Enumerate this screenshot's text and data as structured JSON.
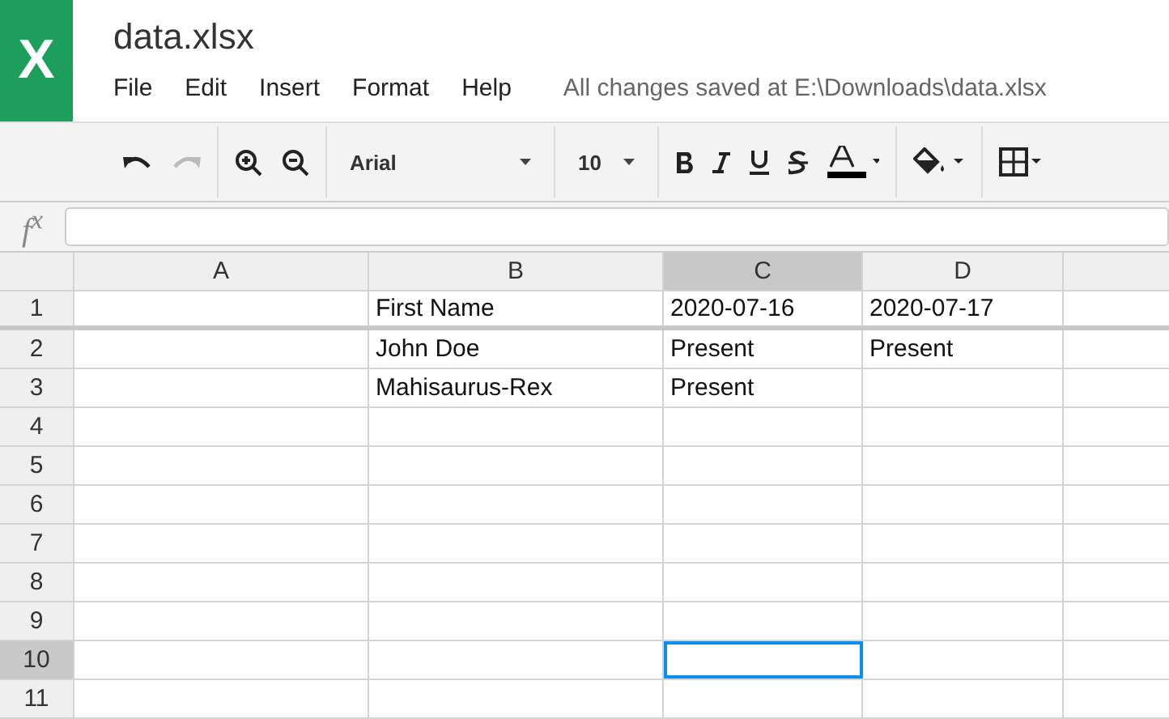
{
  "app": {
    "logo": "X",
    "title": "data.xlsx"
  },
  "menu": [
    "File",
    "Edit",
    "Insert",
    "Format",
    "Help"
  ],
  "save_status": "All changes saved at E:\\Downloads\\data.xlsx",
  "toolbar": [
    [
      {
        "kind": "undo",
        "disabled": false
      },
      {
        "kind": "redo",
        "disabled": true
      }
    ],
    [
      {
        "kind": "zoomin",
        "disabled": false
      },
      {
        "kind": "zoomout",
        "disabled": false
      }
    ],
    [
      {
        "kind": "font",
        "label": "Arial",
        "disabled": false
      }
    ],
    [
      {
        "kind": "size",
        "label": "10",
        "disabled": false
      }
    ],
    [
      {
        "kind": "bold",
        "disabled": false
      },
      {
        "kind": "italic",
        "disabled": false
      },
      {
        "kind": "underline",
        "disabled": false
      },
      {
        "kind": "strike",
        "disabled": false
      },
      {
        "kind": "textcolor",
        "disabled": false
      }
    ],
    [
      {
        "kind": "fillcolor",
        "disabled": false
      }
    ],
    [
      {
        "kind": "borders",
        "disabled": false
      }
    ]
  ],
  "formula_bar": {
    "label": "f$^{x}$"
  },
  "sheet": {
    "columns": [
      {
        "label": "A",
        "selected": false
      },
      {
        "label": "B",
        "selected": false
      },
      {
        "label": "C",
        "selected": true
      },
      {
        "label": "D",
        "selected": false
      },
      {
        "selected": false
      }
    ],
    "rows": [
      {
        "label": "1",
        "selected": false,
        "frozen": true,
        "cells": [
          null,
          "First Name",
          "2020-07-16",
          "2020-07-17",
          null
        ]
      },
      {
        "label": "2",
        "selected": false,
        "frozen": false,
        "cells": [
          null,
          "John Doe",
          "Present",
          "Present",
          null
        ]
      },
      {
        "label": "3",
        "selected": false,
        "frozen": false,
        "cells": [
          null,
          "Mahisaurus-Rex",
          "Present",
          null,
          null
        ]
      },
      {
        "label": "4",
        "selected": false,
        "frozen": false,
        "cells": [
          null,
          null,
          null,
          null,
          null
        ]
      },
      {
        "label": "5",
        "selected": false,
        "frozen": false,
        "cells": [
          null,
          null,
          null,
          null,
          null
        ]
      },
      {
        "label": "6",
        "selected": false,
        "frozen": false,
        "cells": [
          null,
          null,
          null,
          null,
          null
        ]
      },
      {
        "label": "7",
        "selected": false,
        "frozen": false,
        "cells": [
          null,
          null,
          null,
          null,
          null
        ]
      },
      {
        "label": "8",
        "selected": false,
        "frozen": false,
        "cells": [
          null,
          null,
          null,
          null,
          null
        ]
      },
      {
        "label": "9",
        "selected": false,
        "frozen": false,
        "cells": [
          null,
          null,
          null,
          null,
          null
        ]
      },
      {
        "label": "10",
        "selected": true,
        "frozen": false,
        "cells": [
          null,
          null,
          null,
          null,
          null
        ]
      },
      {
        "label": "11",
        "selected": false,
        "frozen": false,
        "cells": [
          null,
          null,
          null,
          null,
          null
        ]
      }
    ]
  }
}
